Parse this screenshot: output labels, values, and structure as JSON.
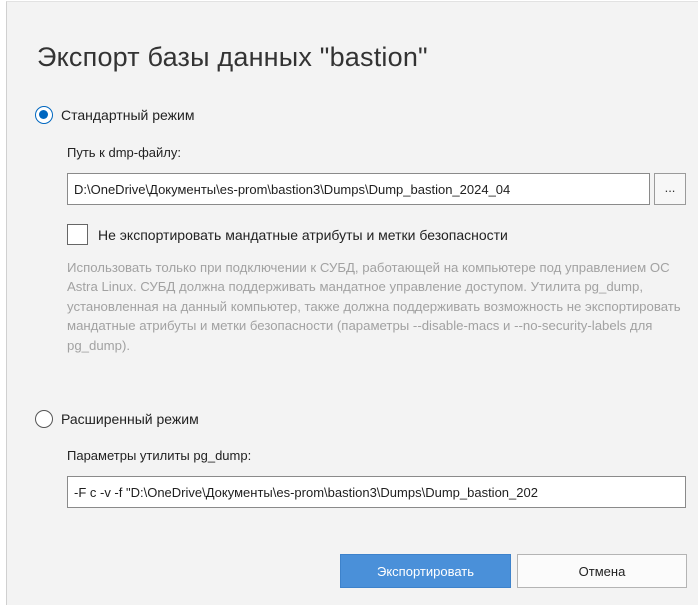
{
  "dialog": {
    "title": "Экспорт базы данных \"bastion\"",
    "standard_mode": {
      "label": "Стандартный режим",
      "selected": true,
      "path_label": "Путь к dmp-файлу:",
      "path_value": "D:\\OneDrive\\Документы\\es-prom\\bastion3\\Dumps\\Dump_bastion_2024_04",
      "browse_label": "...",
      "no_mac_checkbox": {
        "label": "Не экспортировать мандатные атрибуты и метки безопасности",
        "checked": false
      },
      "description": "Использовать только при подключении к СУБД, работающей на компьютере под управлением ОС Astra Linux. СУБД должна поддерживать мандатное управление доступом. Утилита pg_dump, установленная на данный компьютер, также должна поддерживать возможность не экспортировать мандатные атрибуты и метки безопасности (параметры --disable-macs и --no-security-labels для pg_dump)."
    },
    "extended_mode": {
      "label": "Расширенный режим",
      "selected": false,
      "params_label": "Параметры утилиты pg_dump:",
      "params_value": "-F c -v -f \"D:\\OneDrive\\Документы\\es-prom\\bastion3\\Dumps\\Dump_bastion_202"
    },
    "buttons": {
      "export_label": "Экспортировать",
      "cancel_label": "Отмена"
    },
    "colors": {
      "accent": "#0067c0",
      "primary_button": "#4a90d9",
      "background": "#f3f3f3",
      "description_text": "#a2a2a2"
    }
  }
}
